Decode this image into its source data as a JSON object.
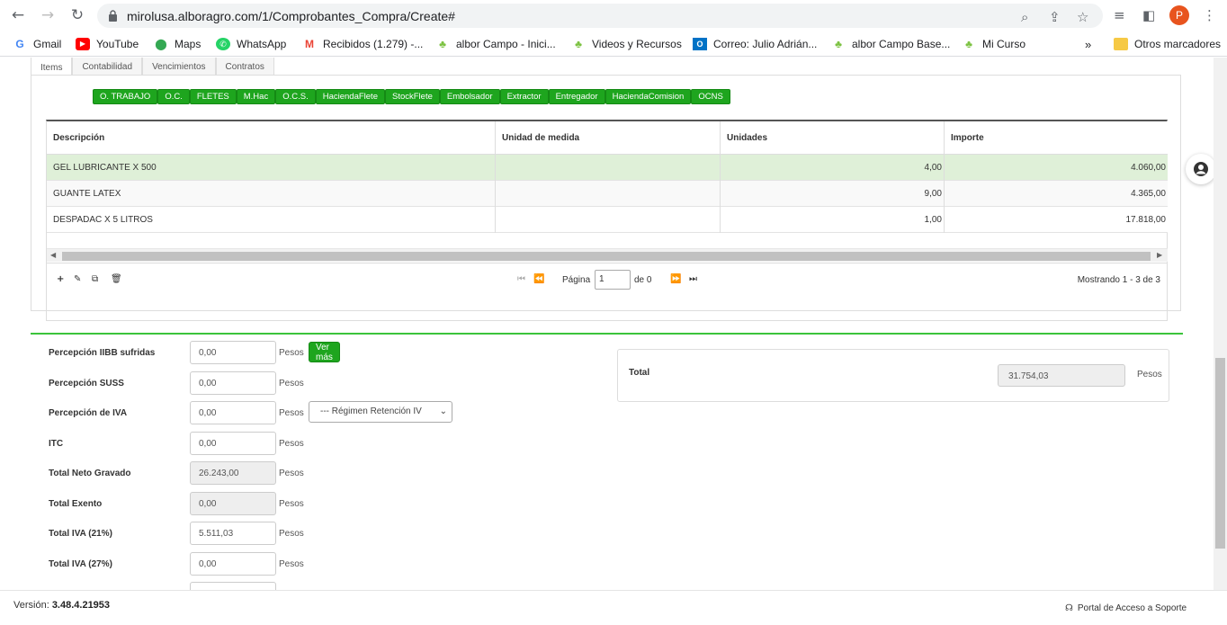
{
  "browser": {
    "url": "mirolusa.alboragro.com/1/Comprobantes_Compra/Create#",
    "profile_initial": "P",
    "icons": {
      "back": "arrow-left",
      "forward": "arrow-right",
      "reload": "reload",
      "lock": "lock",
      "zoom": "magnifier",
      "share": "share",
      "star": "star",
      "media": "media",
      "sidepanel": "side-panel",
      "menu": "kebab"
    }
  },
  "bookmarks": {
    "items": [
      {
        "label": "Gmail",
        "icon": "G"
      },
      {
        "label": "YouTube",
        "icon": "▶"
      },
      {
        "label": "Maps",
        "icon": "⬤"
      },
      {
        "label": "WhatsApp",
        "icon": "✆"
      },
      {
        "label": "Recibidos (1.279) -...",
        "icon": "M"
      },
      {
        "label": "albor Campo - Inici...",
        "icon": "♣"
      },
      {
        "label": "Videos y Recursos",
        "icon": "♣"
      },
      {
        "label": "Correo: Julio Adrián...",
        "icon": "O"
      },
      {
        "label": "albor Campo Base...",
        "icon": "♣"
      },
      {
        "label": "Mi Curso",
        "icon": "♣"
      }
    ],
    "more": "»",
    "other": "Otros marcadores"
  },
  "tabs": [
    "Items",
    "Contabilidad",
    "Vencimientos",
    "Contratos"
  ],
  "toolbar_buttons": [
    "O. TRABAJO",
    "O.C.",
    "FLETES",
    "M.Hac",
    "O.C.S.",
    "HaciendaFlete",
    "StockFlete",
    "Embolsador",
    "Extractor",
    "Entregador",
    "HaciendaComision",
    "OCNS"
  ],
  "grid": {
    "columns": [
      "Descripción",
      "Unidad de medida",
      "Unidades",
      "Importe"
    ],
    "rows": [
      {
        "descripcion": "GEL LUBRICANTE X 500",
        "unidad": "",
        "unidades": "4,00",
        "importe": "4.060,00"
      },
      {
        "descripcion": "GUANTE LATEX",
        "unidad": "",
        "unidades": "9,00",
        "importe": "4.365,00"
      },
      {
        "descripcion": "DESPADAC X 5 LITROS",
        "unidad": "",
        "unidades": "1,00",
        "importe": "17.818,00"
      }
    ],
    "pager": {
      "page_label": "Página",
      "page_value": "1",
      "of_label": "de 0",
      "info": "Mostrando 1 - 3 de 3"
    }
  },
  "totals": {
    "fields": [
      {
        "label": "Percepción IIBB sufridas",
        "value": "0,00",
        "unit": "Pesos",
        "readonly": false
      },
      {
        "label": "Percepción SUSS",
        "value": "0,00",
        "unit": "Pesos",
        "readonly": false
      },
      {
        "label": "Percepción de IVA",
        "value": "0,00",
        "unit": "Pesos",
        "readonly": false
      },
      {
        "label": "ITC",
        "value": "0,00",
        "unit": "Pesos",
        "readonly": false
      },
      {
        "label": "Total Neto Gravado",
        "value": "26.243,00",
        "unit": "Pesos",
        "readonly": true
      },
      {
        "label": "Total Exento",
        "value": "0,00",
        "unit": "Pesos",
        "readonly": true
      },
      {
        "label": "Total IVA (21%)",
        "value": "5.511,03",
        "unit": "Pesos",
        "readonly": false
      },
      {
        "label": "Total IVA (27%)",
        "value": "0,00",
        "unit": "Pesos",
        "readonly": false
      }
    ],
    "ver_mas": "Ver más",
    "regimen_placeholder": "--- Régimen Retención IV",
    "total_label": "Total",
    "total_value": "31.754,03",
    "total_unit": "Pesos"
  },
  "footer": {
    "version_label": "Versión:",
    "version_value": "3.48.4.21953",
    "portal": "Portal de Acceso a Soporte"
  },
  "colors": {
    "accent_green": "#1ea51e",
    "row_highlight": "#dff0d8",
    "section_border": "#3bc43b"
  }
}
